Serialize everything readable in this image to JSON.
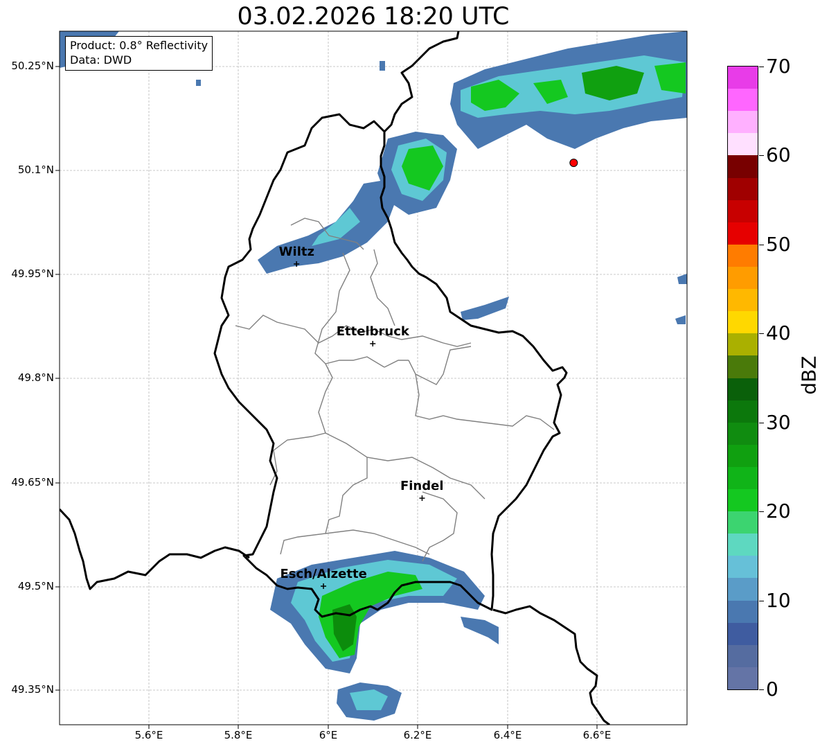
{
  "title": "03.02.2026 18:20 UTC",
  "infobox": {
    "product": "Product: 0.8° Reflectivity",
    "source": "Data: DWD"
  },
  "axes": {
    "lat_ticks": [
      "50.25°N",
      "50.1°N",
      "49.95°N",
      "49.8°N",
      "49.65°N",
      "49.5°N",
      "49.35°N"
    ],
    "lon_ticks": [
      "5.6°E",
      "5.8°E",
      "6°E",
      "6.2°E",
      "6.4°E",
      "6.6°E"
    ]
  },
  "cities": [
    {
      "name": "Wiltz",
      "lon": 5.93,
      "lat": 49.965
    },
    {
      "name": "Ettelbruck",
      "lon": 6.1,
      "lat": 49.85
    },
    {
      "name": "Findel",
      "lon": 6.21,
      "lat": 49.627
    },
    {
      "name": "Esch/Alzette",
      "lon": 5.99,
      "lat": 49.5
    }
  ],
  "radar_site": {
    "lon": 6.548,
    "lat": 50.111,
    "color": "#ff0000"
  },
  "colorbar": {
    "label": "dBZ",
    "ticks": [
      "0",
      "10",
      "20",
      "30",
      "40",
      "50",
      "60",
      "70"
    ],
    "colors": [
      "#6474a6",
      "#556ca0",
      "#3f5ca0",
      "#4a78b0",
      "#5a9cc8",
      "#66c0d8",
      "#5ed8c0",
      "#3cd470",
      "#14c820",
      "#10b418",
      "#10a010",
      "#108c10",
      "#0c780c",
      "#0a600a",
      "#4a7a0a",
      "#aab000",
      "#ffd800",
      "#ffb800",
      "#ff9c00",
      "#ff7c00",
      "#e60000",
      "#c80000",
      "#a00000",
      "#780000",
      "#ffe0ff",
      "#ffb0ff",
      "#ff66ff",
      "#e83ce8"
    ]
  }
}
